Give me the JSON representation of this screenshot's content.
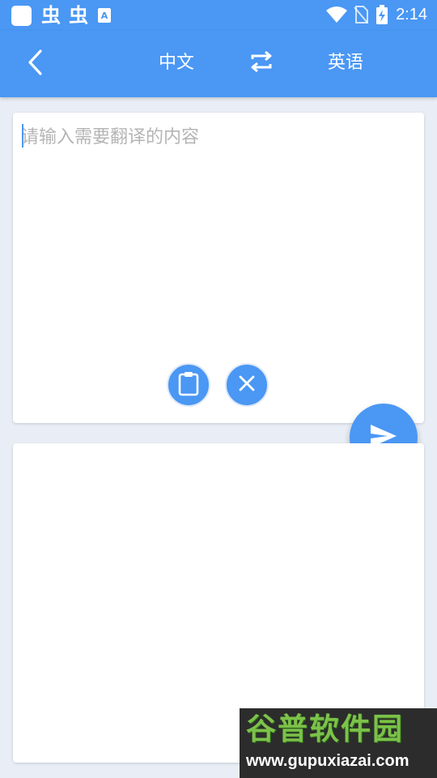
{
  "status_bar": {
    "time": "2:14",
    "notification_glyphs": [
      "虫",
      "虫"
    ],
    "a_badge": "A",
    "icons": [
      "app-square-icon",
      "wifi-icon",
      "no-sim-icon",
      "battery-charging-icon"
    ]
  },
  "app_bar": {
    "back_icon": "chevron-left-icon",
    "source_language": "中文",
    "target_language": "英语",
    "swap_icon": "swap-arrows-icon"
  },
  "input_card": {
    "placeholder": "请输入需要翻译的内容",
    "value": "",
    "paste_icon": "clipboard-icon",
    "clear_icon": "close-icon"
  },
  "send_icon": "send-icon",
  "output_card": {
    "text": ""
  },
  "watermark": {
    "title": "谷普软件园",
    "url": "www.gupuxiazai.com"
  },
  "colors": {
    "primary": "#4a97f4",
    "background": "#e9eef6",
    "card": "#ffffff",
    "placeholder": "#b5b5b5"
  }
}
